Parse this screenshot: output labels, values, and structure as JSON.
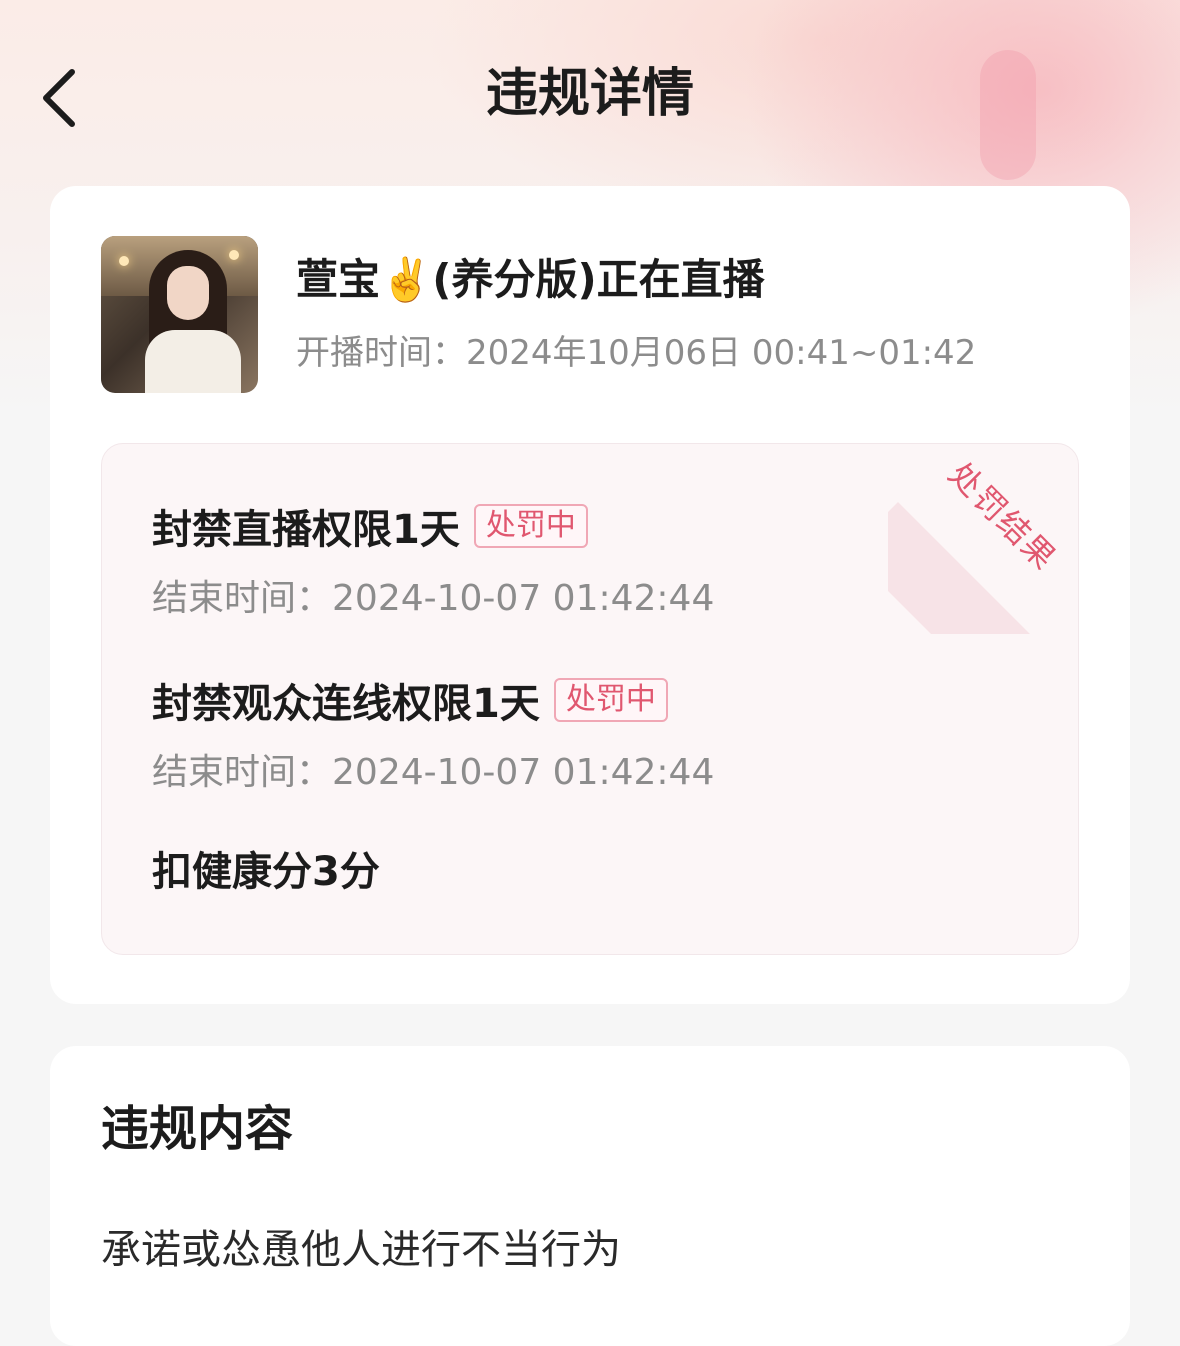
{
  "nav": {
    "title": "违规详情",
    "back_icon": "chevron-left-icon"
  },
  "stream": {
    "name": "萱宝✌️(养分版)正在直播",
    "time_label": "开播时间：",
    "time_value": "2024年10月06日 00:41~01:42"
  },
  "penalty": {
    "ribbon": "处罚结果",
    "items": [
      {
        "title": "封禁直播权限1天",
        "badge": "处罚中",
        "end_label": "结束时间：",
        "end_value": "2024-10-07 01:42:44"
      },
      {
        "title": "封禁观众连线权限1天",
        "badge": "处罚中",
        "end_label": "结束时间：",
        "end_value": "2024-10-07 01:42:44"
      },
      {
        "title": "扣健康分3分"
      }
    ]
  },
  "violation": {
    "section_title": "违规内容",
    "text": "承诺或怂恿他人进行不当行为"
  },
  "colors": {
    "accent": "#e0576f",
    "badge_border": "#f0a7b5",
    "muted_text": "#8c8c8c",
    "penalty_bg": "#fcf6f7"
  }
}
